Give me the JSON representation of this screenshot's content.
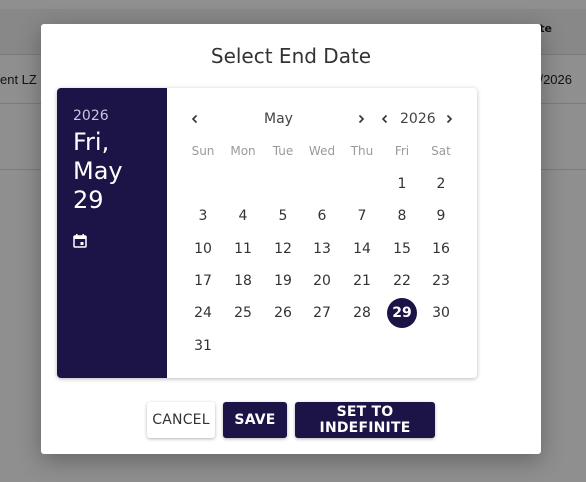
{
  "background": {
    "header_right": "ite",
    "row_left": "ent LZ",
    "row_right": "/2026"
  },
  "dialog": {
    "title": "Select End Date"
  },
  "picker": {
    "side": {
      "year": "2026",
      "weekday": "Fri,",
      "month": "May",
      "day": "29",
      "icon": "calendar-icon"
    },
    "nav": {
      "month": "May",
      "year": "2026",
      "prev_month_icon": "chevron-left-icon",
      "next_month_icon": "chevron-right-icon",
      "prev_year_icon": "chevron-left-icon",
      "next_year_icon": "chevron-right-icon"
    },
    "weekdays": [
      "Sun",
      "Mon",
      "Tue",
      "Wed",
      "Thu",
      "Fri",
      "Sat"
    ],
    "first_weekday_index": 5,
    "days_in_month": 31,
    "selected_day": 29
  },
  "actions": {
    "cancel": "CANCEL",
    "save": "SAVE",
    "set_indefinite": "SET TO INDEFINITE"
  },
  "colors": {
    "accent": "#1c1446"
  }
}
